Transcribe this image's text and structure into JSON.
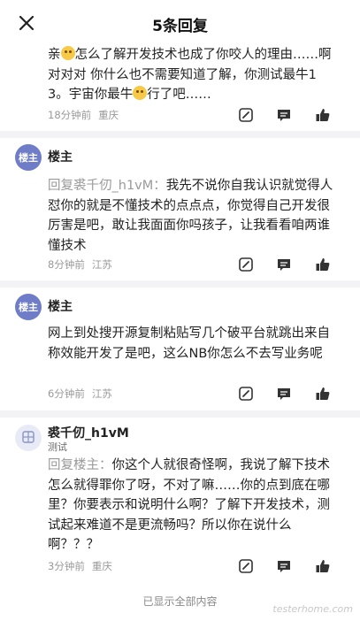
{
  "header": {
    "title": "5条回复",
    "close_icon": "close-icon"
  },
  "posts": [
    {
      "text_a": "亲",
      "text_b": "怎么了解开发技术也成了你咬人的理由……啊 对对对 你什么也不需要知道了解，你测试最牛13。宇宙你最牛",
      "text_c": "行了吧……",
      "time": "18分钟前",
      "location": "重庆"
    },
    {
      "author": "楼主",
      "avatar_text": "楼主",
      "reply_prefix": "回复裘千仞_h1vM：",
      "text": "我先不说你自我认识就觉得人怼你的就是不懂技术的点点点，你觉得自己开发很厉害是吧，敢让我面面你吗孩子，让我看看咱两谁懂技术",
      "time": "8分钟前",
      "location": "江苏"
    },
    {
      "author": "楼主",
      "avatar_text": "楼主",
      "text": "网上到处搜开源复制粘贴写几个破平台就跳出来自称效能开发了是吧，这么NB你怎么不去写业务呢",
      "time": "6分钟前",
      "location": "江苏"
    },
    {
      "author": "裘千仞_h1vM",
      "subtitle": "测试",
      "reply_prefix": "回复楼主：",
      "text": "你这个人就很奇怪啊，我说了解下技术怎么就得罪你了呀，不对了嘛……你的点到底在哪里？你要表示和说明什么啊？了解下开发技术，测试起来难道不是更流畅吗？所以你在说什么啊？？？",
      "time": "3分钟前",
      "location": "重庆"
    }
  ],
  "footer": {
    "text": "已显示全部内容"
  },
  "watermark": {
    "text": "testerhome.com"
  },
  "colors": {
    "accent": "#6f7dc9",
    "meta": "#999999",
    "divider": "#f3f3f5"
  }
}
